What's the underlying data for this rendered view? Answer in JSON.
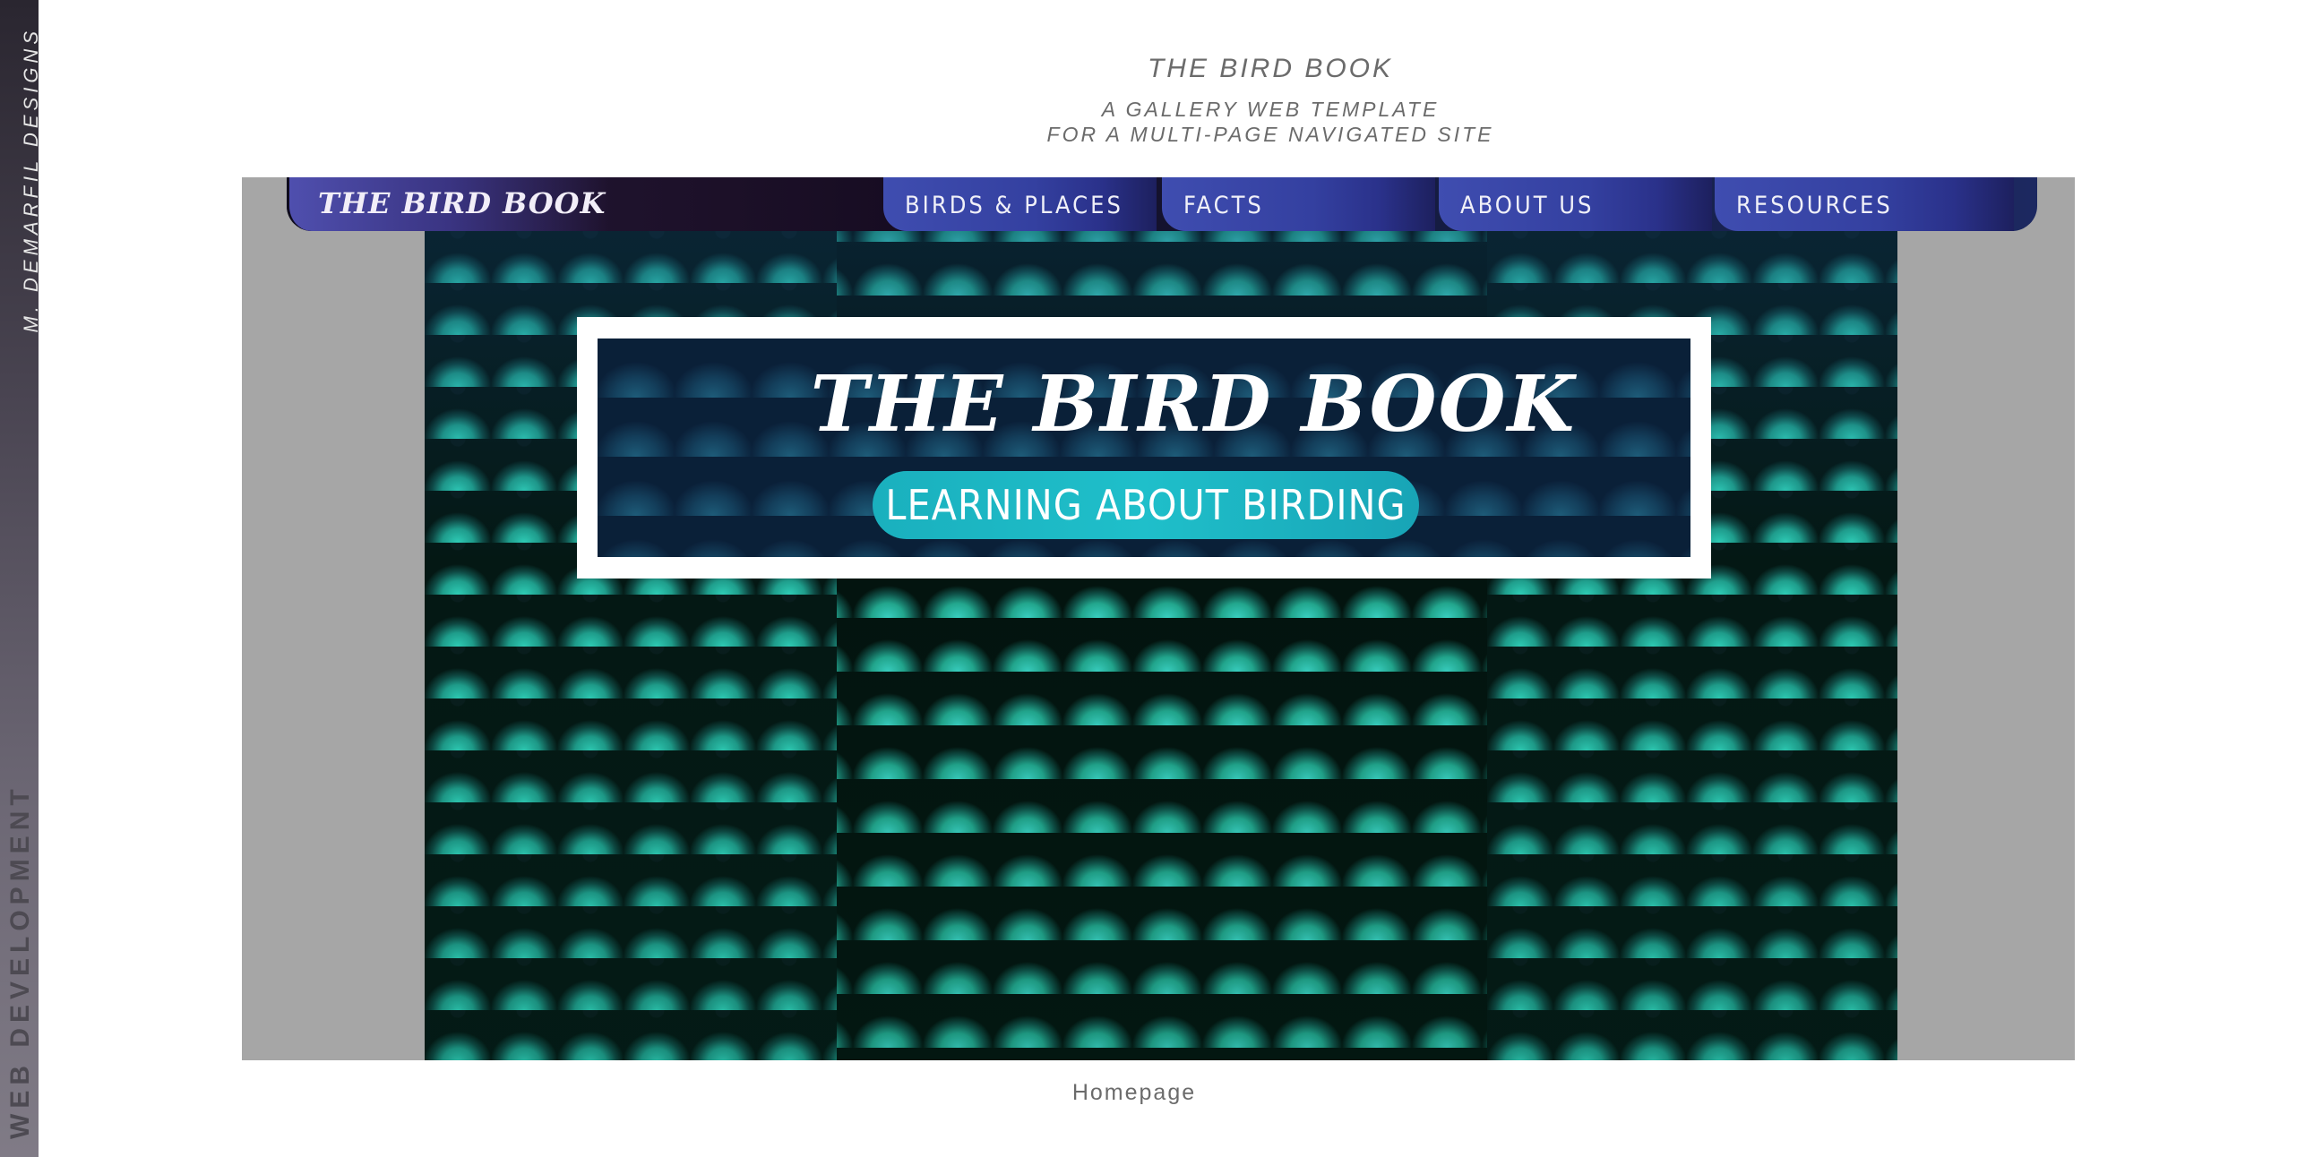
{
  "sidebar": {
    "top_label": "M. DEMARFIL DESIGNS",
    "bottom_label": "WEB DEVELOPMENT"
  },
  "header": {
    "title": "THE BIRD BOOK",
    "subtitle_line1": "A GALLERY WEB TEMPLATE",
    "subtitle_line2": "FOR A MULTI-PAGE NAVIGATED SITE"
  },
  "nav": {
    "logo": "THE BIRD BOOK",
    "items": [
      {
        "label": "BIRDS & PLACES"
      },
      {
        "label": "FACTS"
      },
      {
        "label": "ABOUT US"
      },
      {
        "label": "RESOURCES"
      }
    ]
  },
  "banner": {
    "title": "THE BIRD BOOK",
    "tagline": "LEARNING ABOUT BIRDING"
  },
  "caption": "Homepage",
  "colors": {
    "nav_accent": "#3f4db0",
    "pill": "#1fbfca",
    "frame": "#a6a6a6"
  }
}
